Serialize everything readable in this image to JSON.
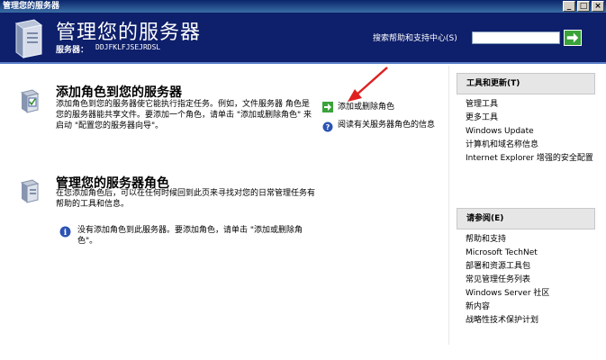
{
  "window": {
    "title": "管理您的服务器",
    "buttons": [
      "_",
      "□",
      "×"
    ]
  },
  "header": {
    "title": "管理您的服务器",
    "server_label": "服务器：",
    "server_name": "DDJFKLFJSEJRDSL",
    "search_label": "搜索帮助和支持中心(S)",
    "search_value": ""
  },
  "sections": [
    {
      "title": "添加角色到您的服务器",
      "desc": "添加角色到您的服务器使它能执行指定任务。例如，文件服务器 角色是您的服务器能共享文件。要添加一个角色，请单击 \"添加或删除角色\" 来启动 \"配置您的服务器向导\"。"
    },
    {
      "title": "管理您的服务器角色",
      "desc": "在您添加角色后，可以在任何时候回到此页来寻找对您的日常管理任务有帮助的工具和信息。",
      "note": "没有添加角色到此服务器。要添加角色，请单击 \"添加或删除角色\"。"
    }
  ],
  "tasks": [
    {
      "label": "添加或删除角色"
    },
    {
      "label": "阅读有关服务器角色的信息"
    }
  ],
  "panels": [
    {
      "title": "工具和更新(T)",
      "items": [
        "管理工具",
        "更多工具",
        "Windows Update",
        "计算机和域名称信息",
        "Internet Explorer 增强的安全配置"
      ]
    },
    {
      "title": "请参阅(E)",
      "items": [
        "帮助和支持",
        "Microsoft TechNet",
        "部署和资源工具包",
        "常见管理任务列表",
        "Windows Server 社区",
        "新内容",
        "战略性技术保护计划"
      ]
    }
  ]
}
